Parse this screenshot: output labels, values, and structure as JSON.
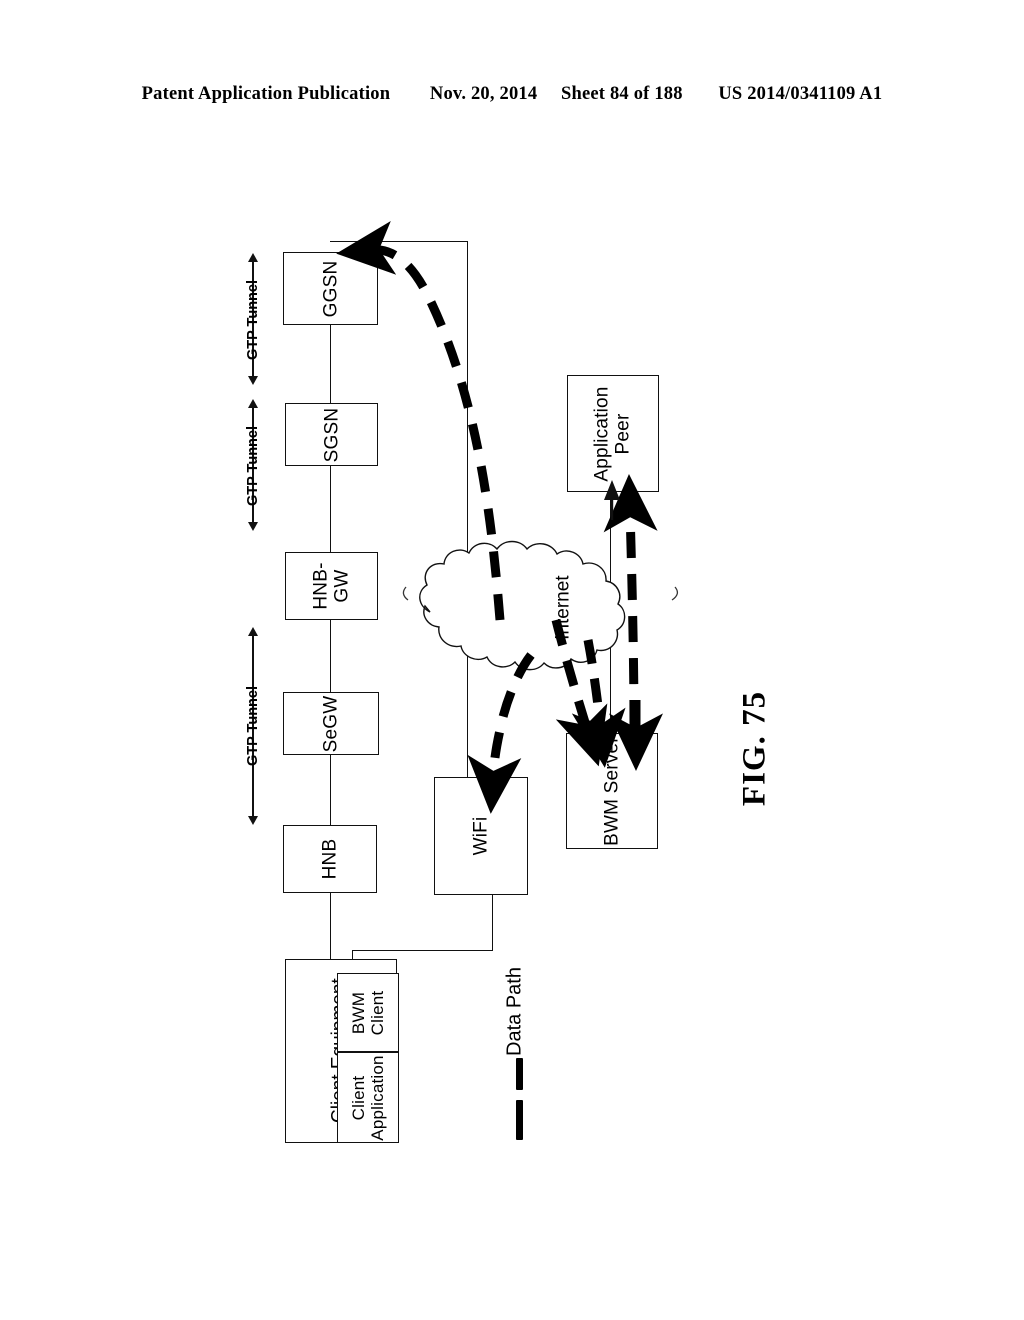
{
  "header": {
    "publication": "Patent Application Publication",
    "date": "Nov. 20, 2014",
    "sheet": "Sheet 84 of 188",
    "number": "US 2014/0341109 A1"
  },
  "figure": {
    "label": "FIG. 75",
    "legend": {
      "data_path_label": "Data Path"
    },
    "nodes": {
      "ggsn": "GGSN",
      "sgsn": "SGSN",
      "hnb_gw": "HNB-\nGW",
      "hnb_gw_line1": "HNB-",
      "hnb_gw_line2": "GW",
      "segw": "SeGW",
      "hnb": "HNB",
      "wifi": "WiFi",
      "internet": "Internet",
      "application_peer_line1": "Application",
      "application_peer_line2": "Peer",
      "bwm_server": "BWM Server",
      "client_equipment": "Client Equipment",
      "bwm_client_line1": "BWM",
      "bwm_client_line2": "Client",
      "client_application_line1": "Client",
      "client_application_line2": "Application"
    },
    "tunnels": [
      {
        "label": "GTP Tunnel"
      },
      {
        "label": "GTP Tunnel"
      },
      {
        "label": "GTP Tunnel"
      }
    ],
    "colors": {
      "ink": "#111111",
      "paper": "#ffffff",
      "data_path": "#000000"
    }
  }
}
